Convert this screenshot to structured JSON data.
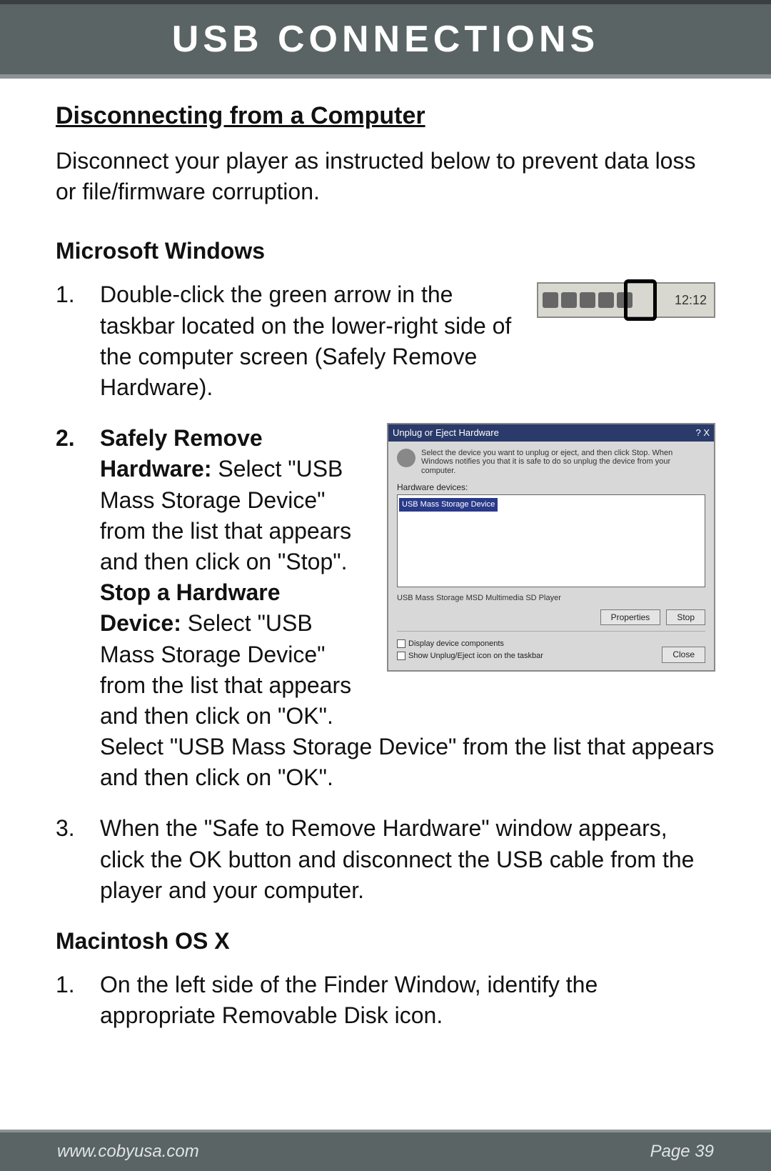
{
  "header": {
    "title": "USB CONNECTIONS"
  },
  "section": {
    "title": "Disconnecting from a Computer",
    "intro": "Disconnect your player as instructed below to prevent data loss or file/firmware corruption."
  },
  "windows": {
    "heading": "Microsoft Windows",
    "steps": {
      "s1_num": "1.",
      "s1_text": "Double-click the green arrow in the taskbar located on the lower-right side of the computer screen (Safely Remove Hardware).",
      "s2_num": "2.",
      "s2_bold1": "Safely Remove Hardware:",
      "s2_text1": " Select \"USB Mass Storage Device\" from the list that appears and then click on \"Stop\". ",
      "s2_bold2": "Stop a Hardware Device:",
      "s2_text2": "  Select \"USB Mass Storage Device\" from the list that appears and then click on \"OK\".",
      "s2_text3": "Select \"USB Mass Storage Device\" from the list that appears and then click on \"OK\".",
      "s3_num": "3.",
      "s3_text": "When the \"Safe to Remove Hardware\" window appears, click the OK button and disconnect the USB cable from the player and your computer."
    }
  },
  "mac": {
    "heading": "Macintosh OS X",
    "steps": {
      "s1_num": "1.",
      "s1_text": "On the left side of the Finder Window, identify the appropriate Removable Disk icon."
    }
  },
  "taskbar": {
    "clock": "12:12"
  },
  "dialog": {
    "title": "Unplug or Eject Hardware",
    "close": "? X",
    "info": "Select the device you want to unplug or eject, and then click Stop. When Windows notifies you that it is safe to do so unplug the device from your computer.",
    "hardware_label": "Hardware devices:",
    "list_item": "USB Mass Storage Device",
    "desc": "USB Mass Storage MSD Multimedia SD Player",
    "btn_properties": "Properties",
    "btn_stop": "Stop",
    "chk1": "Display device components",
    "chk2": "Show Unplug/Eject icon on the taskbar",
    "btn_close": "Close"
  },
  "footer": {
    "url": "www.cobyusa.com",
    "page": "Page 39"
  }
}
